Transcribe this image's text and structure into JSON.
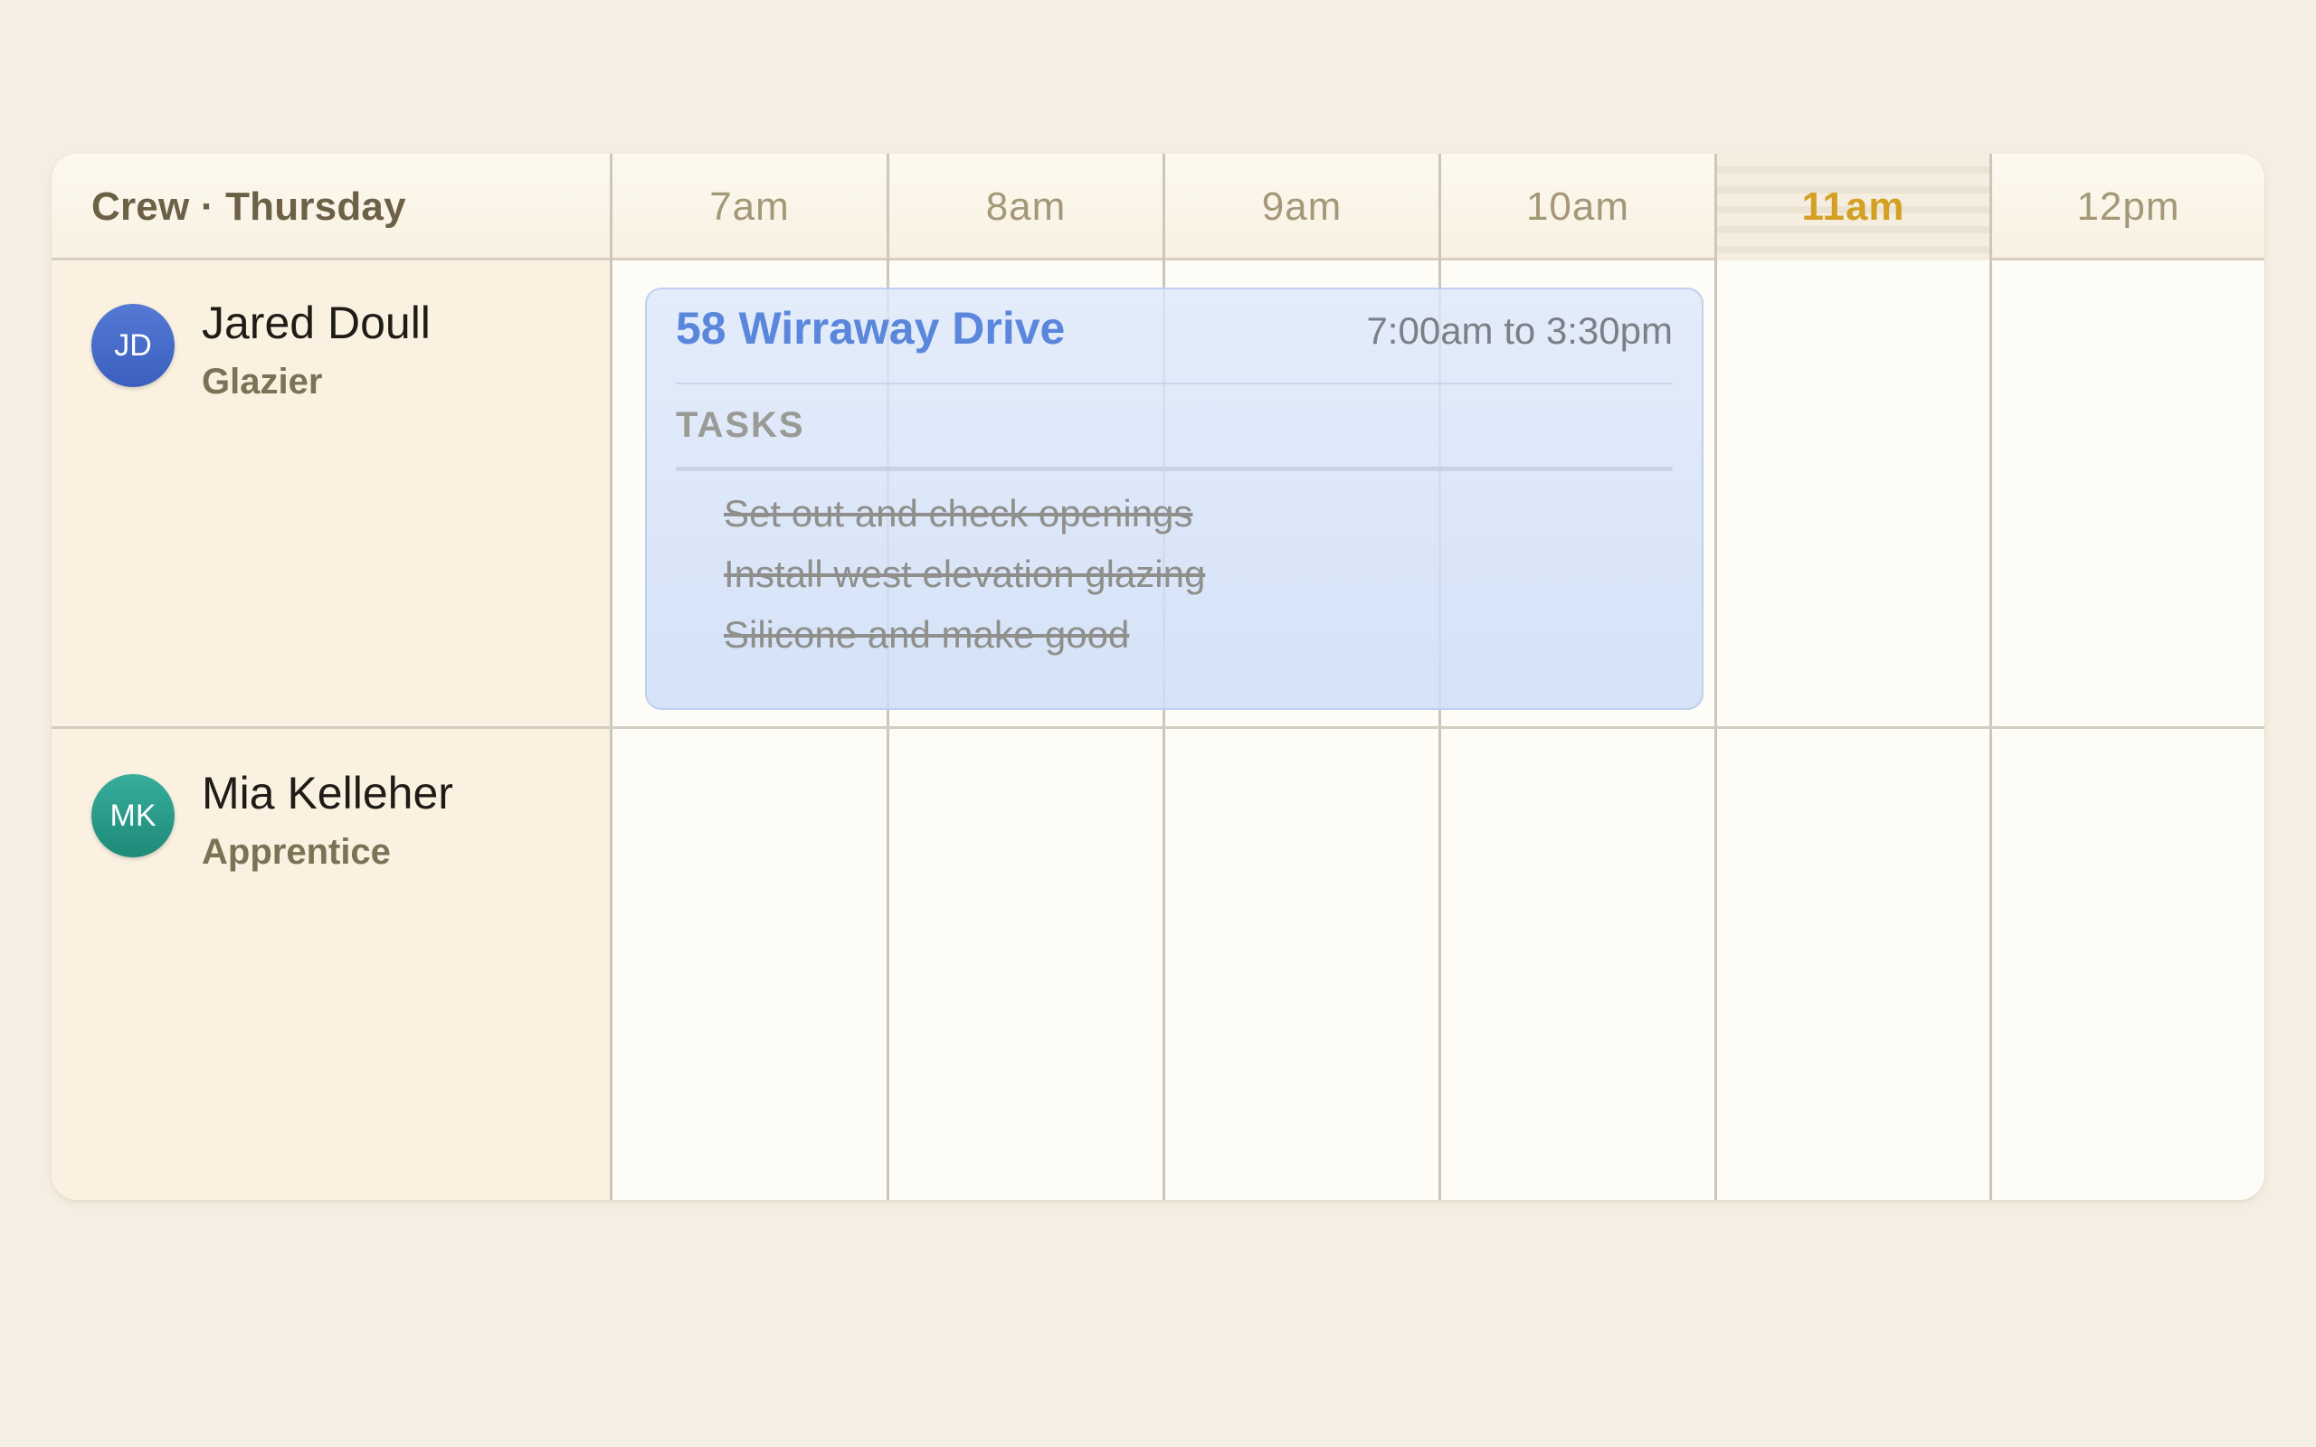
{
  "header": {
    "crew_title": "Crew · Thursday",
    "hours": [
      "7am",
      "8am",
      "9am",
      "10am",
      "11am",
      "12pm"
    ],
    "current_hour": "11am"
  },
  "crew": [
    {
      "initials": "JD",
      "name": "Jared Doull",
      "role": "Glazier",
      "avatar_color": "#4468c8"
    },
    {
      "initials": "MK",
      "name": "Mia Kelleher",
      "role": "Apprentice",
      "avatar_color": "#279a88"
    }
  ],
  "job": {
    "title": "58 Wirraway Drive",
    "time": "7:00am to 3:30pm",
    "tasks_label": "TASKS",
    "tasks": [
      {
        "label": "Set out and check openings",
        "done": true
      },
      {
        "label": "Install west elevation glazing",
        "done": true
      },
      {
        "label": "Silicone and make good",
        "done": true
      }
    ],
    "accent_color": "#5a86dc"
  },
  "colors": {
    "background": "#f5eee2",
    "crew_column": "#faf1e1",
    "current_hour_text": "#d4a024"
  }
}
